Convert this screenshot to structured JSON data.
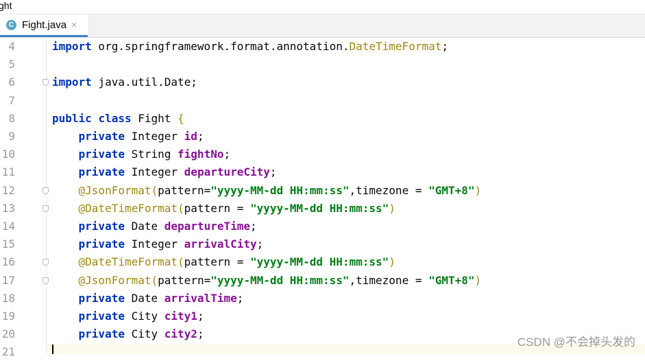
{
  "window": {
    "title": "ght"
  },
  "tab": {
    "icon_letter": "C",
    "label": "Fight.java",
    "close": "×"
  },
  "lines": [
    {
      "n": "4",
      "code": "import org.springframework.format.annotation.DateTimeFormat;"
    },
    {
      "n": "5",
      "code": ""
    },
    {
      "n": "6",
      "code": "import java.util.Date;"
    },
    {
      "n": "7",
      "code": ""
    },
    {
      "n": "8",
      "code": "public class Fight {"
    },
    {
      "n": "9",
      "code": "    private Integer id;"
    },
    {
      "n": "10",
      "code": "    private String fightNo;"
    },
    {
      "n": "11",
      "code": "    private Integer departureCity;"
    },
    {
      "n": "12",
      "code": "    @JsonFormat(pattern=\"yyyy-MM-dd HH:mm:ss\",timezone = \"GMT+8\")"
    },
    {
      "n": "13",
      "code": "    @DateTimeFormat(pattern = \"yyyy-MM-dd HH:mm:ss\")"
    },
    {
      "n": "14",
      "code": "    private Date departureTime;"
    },
    {
      "n": "15",
      "code": "    private Integer arrivalCity;"
    },
    {
      "n": "16",
      "code": "    @DateTimeFormat(pattern = \"yyyy-MM-dd HH:mm:ss\")"
    },
    {
      "n": "17",
      "code": "    @JsonFormat(pattern=\"yyyy-MM-dd HH:mm:ss\",timezone = \"GMT+8\")"
    },
    {
      "n": "18",
      "code": "    private Date arrivalTime;"
    },
    {
      "n": "19",
      "code": "    private City city1;"
    },
    {
      "n": "20",
      "code": "    private City city2;"
    },
    {
      "n": "21",
      "code": ""
    }
  ],
  "watermark": "CSDN @不会掉头发的",
  "colors": {
    "keyword": "#0033b3",
    "annotation": "#9e880d",
    "string": "#067d17",
    "field": "#871094",
    "tab_underline": "#4083c9"
  }
}
